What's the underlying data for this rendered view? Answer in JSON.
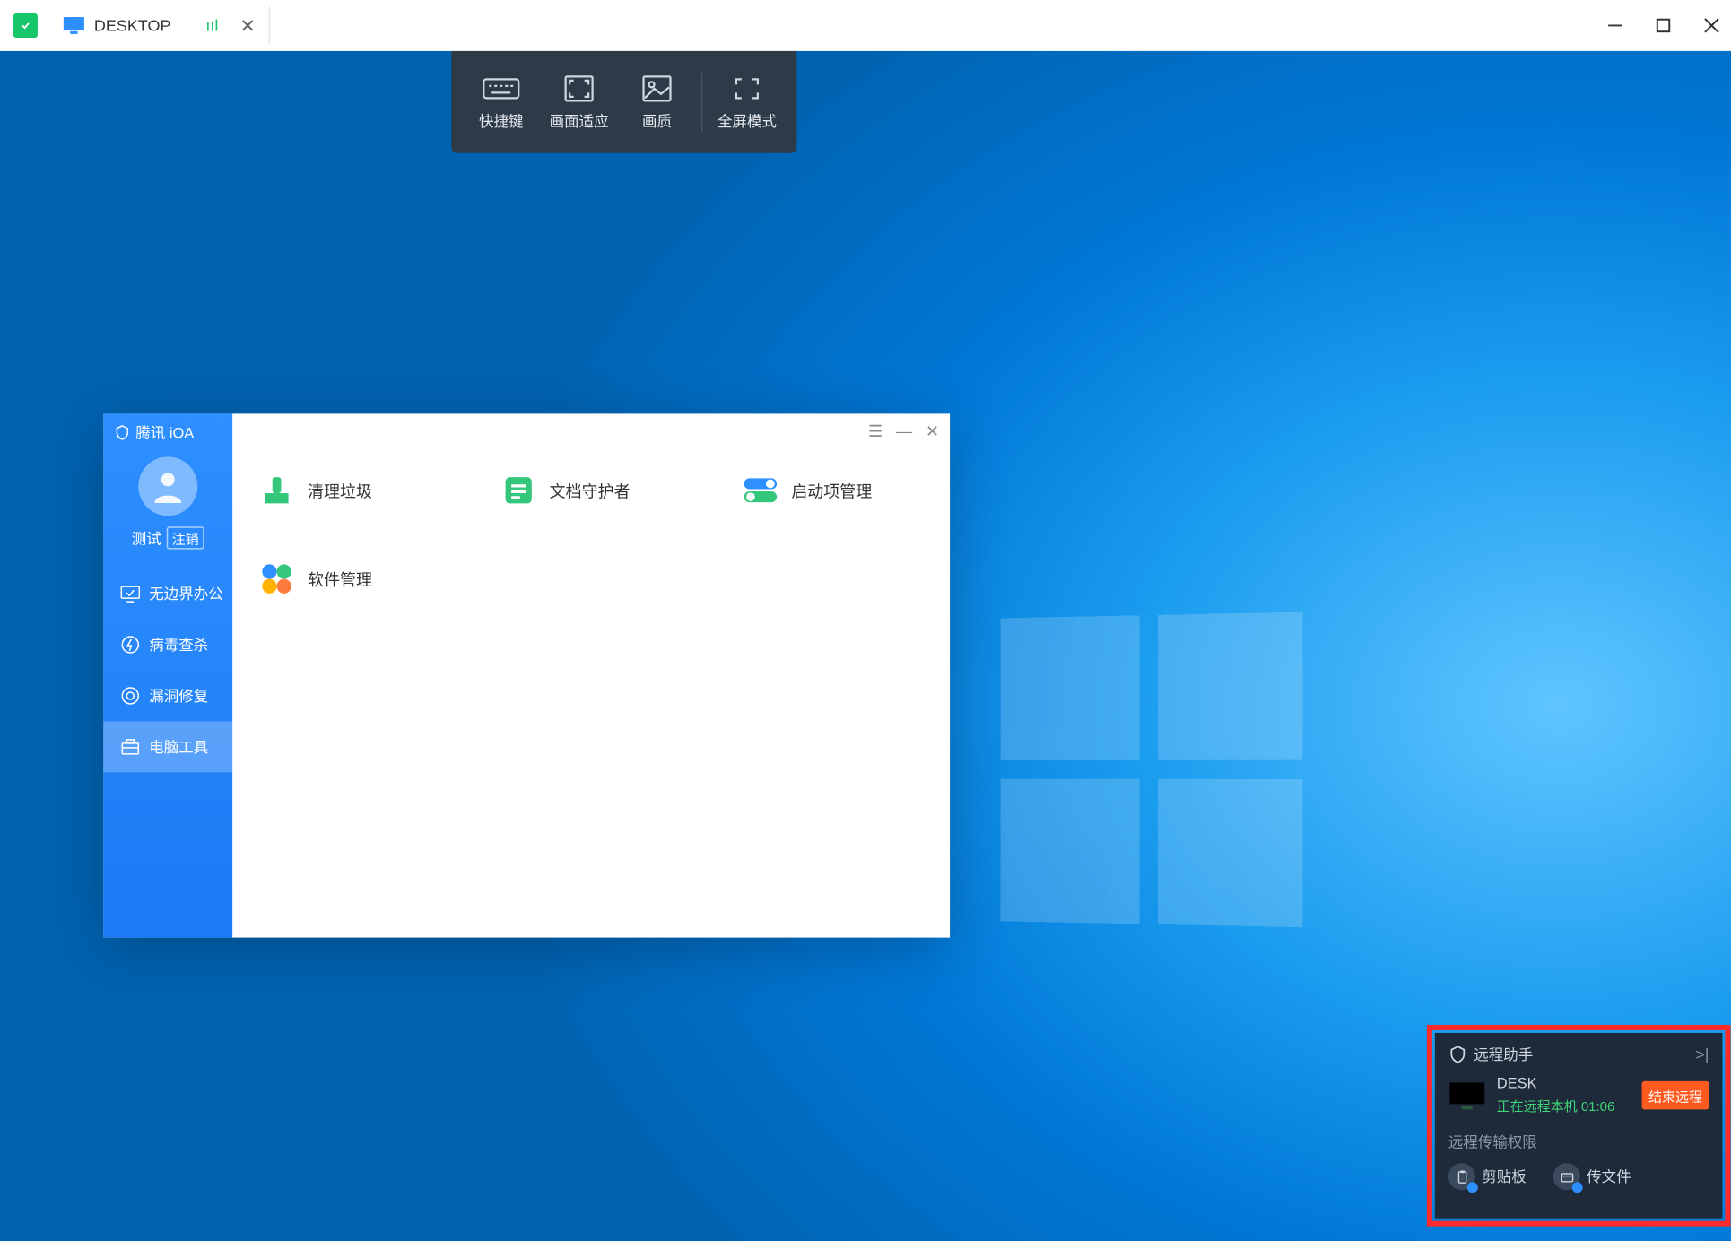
{
  "titlebar": {
    "tab_title": "DESKTOP",
    "signal": "ııl"
  },
  "toolbar": {
    "shortcut": "快捷键",
    "fit": "画面适应",
    "quality": "画质",
    "fullscreen": "全屏模式"
  },
  "ioa": {
    "title": "腾讯 iOA",
    "user": "测试",
    "logout": "注销",
    "nav": {
      "borderless": "无边界办公",
      "virus": "病毒查杀",
      "vuln": "漏洞修复",
      "tools": "电脑工具"
    },
    "tools": {
      "clean": "清理垃圾",
      "docguard": "文档守护者",
      "startup": "启动项管理",
      "software": "软件管理"
    }
  },
  "assistant": {
    "title": "远程助手",
    "device": "DESK",
    "status": "正在远程本机 01:06",
    "end": "结束远程",
    "perm_title": "远程传输权限",
    "clipboard": "剪贴板",
    "file": "传文件"
  }
}
